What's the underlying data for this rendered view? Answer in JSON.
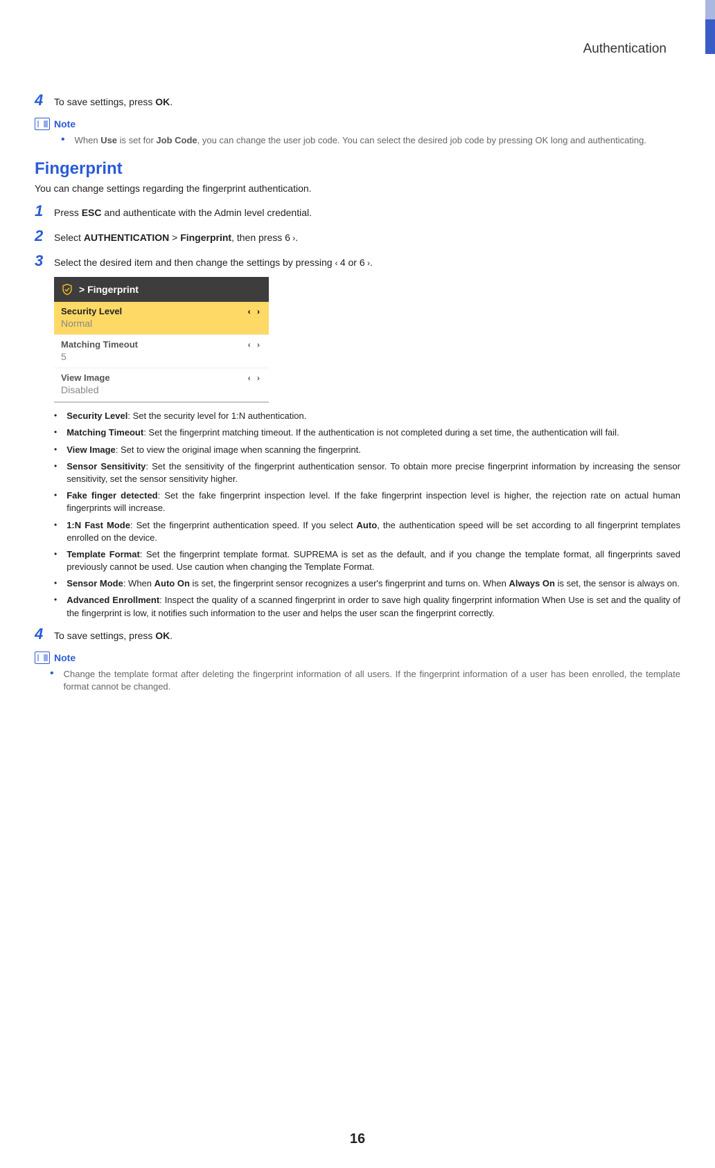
{
  "header": {
    "title": "Authentication"
  },
  "step4a": {
    "num": "4",
    "text_pre": "To save settings, press ",
    "ok": "OK",
    "text_post": "."
  },
  "note1": {
    "label": "Note",
    "bullet_pre": "When ",
    "use": "Use",
    "mid1": " is set for ",
    "jobcode": "Job Code",
    "rest": ", you can change the user job code. You can select the desired job code by pressing OK long and authenticating."
  },
  "fingerprint": {
    "heading": "Fingerprint",
    "intro": "You can change settings regarding the fingerprint authentication."
  },
  "steps": {
    "s1": {
      "num": "1",
      "pre": "Press ",
      "esc": "ESC",
      "post": " and authenticate with the Admin level credential."
    },
    "s2": {
      "num": "2",
      "pre": "Select ",
      "auth": "AUTHENTICATION",
      "gt": " > ",
      "fp": "Fingerprint",
      "mid": ", then press ",
      "key": "6",
      "arrow": " ›",
      "post": "."
    },
    "s3": {
      "num": "3",
      "pre": "Select the desired item and then change the settings by pressing ",
      "a1": "‹ ",
      "k1": "4",
      "or": " or ",
      "k2": "6",
      "a2": " ›",
      "post": "."
    }
  },
  "screenshot": {
    "breadcrumb": "> Fingerprint",
    "rows": [
      {
        "label": "Security Level",
        "value": "Normal",
        "selected": true
      },
      {
        "label": "Matching Timeout",
        "value": "5",
        "selected": false
      },
      {
        "label": "View Image",
        "value": "Disabled",
        "selected": false
      }
    ]
  },
  "bullets": {
    "b1": {
      "title": "Security Level",
      "text": ": Set the security level for 1:N authentication."
    },
    "b2": {
      "title": "Matching Timeout",
      "text": ": Set the fingerprint matching timeout. If the authentication is not completed during a set time, the authentication will fail."
    },
    "b3": {
      "title": "View Image",
      "text": ": Set to view the original image when scanning the fingerprint."
    },
    "b4": {
      "title": "Sensor Sensitivity",
      "text": ": Set the sensitivity of the fingerprint authentication sensor. To obtain more precise fingerprint information by increasing the sensor sensitivity, set the sensor sensitivity higher."
    },
    "b5": {
      "title": "Fake finger detected",
      "text": ": Set the fake fingerprint inspection level. If the fake fingerprint inspection level is higher, the rejection rate on actual human fingerprints will increase."
    },
    "b6": {
      "title": "1:N Fast Mode",
      "pre": ": Set the fingerprint authentication speed. If you select ",
      "auto": "Auto",
      "post": ", the authentication speed will be set according to all fingerprint templates enrolled on the device."
    },
    "b7": {
      "title": "Template Format",
      "text": ": Set the fingerprint template format. SUPREMA is set as the default, and if you change the template format, all fingerprints saved previously cannot be used. Use caution when changing the Template Format."
    },
    "b8": {
      "title": "Sensor Mode",
      "pre": ": When ",
      "auto_on": "Auto On",
      "mid": " is set, the fingerprint sensor recognizes a user's fingerprint and turns on. When ",
      "always_on": "Always On",
      "post": " is set, the sensor is always on."
    },
    "b9": {
      "title": "Advanced Enrollment",
      "text": ": Inspect the quality of a scanned fingerprint in order to save high quality fingerprint information When Use is set and the quality of the fingerprint is low, it notifies such information to the user and helps the user scan the fingerprint correctly."
    }
  },
  "step4b": {
    "num": "4",
    "text_pre": "To save settings, press ",
    "ok": "OK",
    "text_post": "."
  },
  "note2": {
    "label": "Note",
    "text": "Change the template format after deleting the fingerprint information of all users. If the fingerprint information of a user has been enrolled, the template format cannot be changed."
  },
  "page_number": "16"
}
